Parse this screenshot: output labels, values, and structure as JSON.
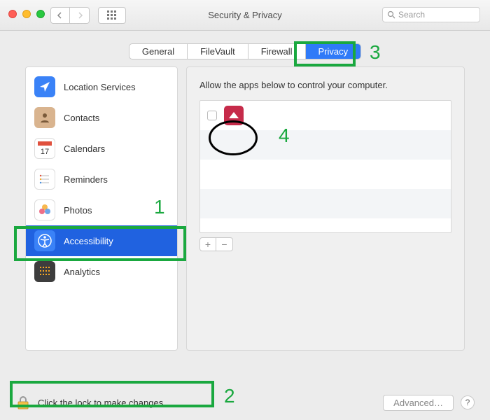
{
  "window": {
    "title": "Security & Privacy",
    "search_placeholder": "Search"
  },
  "tabs": [
    {
      "label": "General",
      "active": false
    },
    {
      "label": "FileVault",
      "active": false
    },
    {
      "label": "Firewall",
      "active": false
    },
    {
      "label": "Privacy",
      "active": true
    }
  ],
  "sidebar": {
    "items": [
      {
        "label": "Location Services",
        "icon": "location-arrow-icon",
        "selected": false
      },
      {
        "label": "Contacts",
        "icon": "contacts-icon",
        "selected": false
      },
      {
        "label": "Calendars",
        "icon": "calendar-icon",
        "selected": false
      },
      {
        "label": "Reminders",
        "icon": "reminders-icon",
        "selected": false
      },
      {
        "label": "Photos",
        "icon": "photos-icon",
        "selected": false
      },
      {
        "label": "Accessibility",
        "icon": "accessibility-icon",
        "selected": true
      },
      {
        "label": "Analytics",
        "icon": "analytics-icon",
        "selected": false
      }
    ]
  },
  "content": {
    "instruction": "Allow the apps below to control your computer.",
    "apps": [
      {
        "name": "",
        "checked": false
      }
    ],
    "add_label": "+",
    "remove_label": "−"
  },
  "bottom": {
    "lock_text": "Click the lock to make changes.",
    "advanced_label": "Advanced…",
    "help_label": "?"
  },
  "annotations": {
    "n1": "1",
    "n2": "2",
    "n3": "3",
    "n4": "4"
  }
}
